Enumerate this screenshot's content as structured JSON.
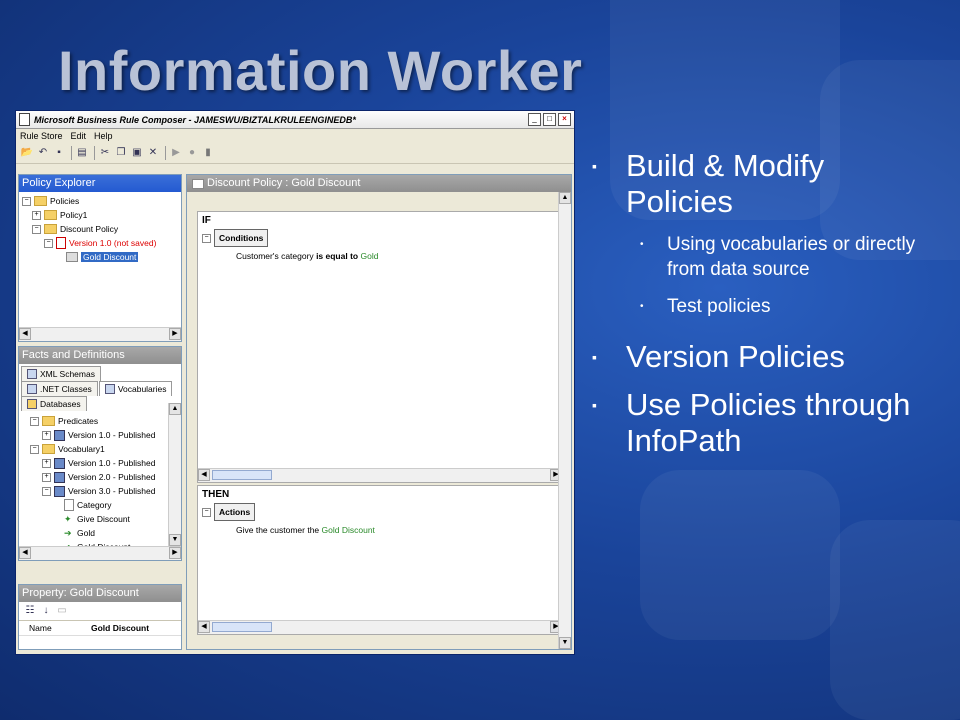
{
  "slide": {
    "title": "Information Worker",
    "bullets": [
      {
        "text": "Build & Modify Policies",
        "sub": [
          "Using vocabularies or directly from data source",
          "Test policies"
        ]
      },
      {
        "text": "Version Policies",
        "sub": []
      },
      {
        "text": "Use Policies through InfoPath",
        "sub": []
      }
    ]
  },
  "app": {
    "title": "Microsoft Business Rule Composer - JAMESWU/BIZTALKRULEENGINEDB*",
    "menu": [
      "Rule Store",
      "Edit",
      "Help"
    ],
    "policy_explorer": {
      "header": "Policy Explorer",
      "root": "Policies",
      "items": [
        "Policy1",
        "Discount Policy",
        "Version 1.0 (not saved)",
        "Gold Discount"
      ]
    },
    "facts": {
      "header": "Facts and Definitions",
      "tabs": [
        "XML Schemas",
        ".NET Classes",
        "Vocabularies",
        "Databases"
      ],
      "items": [
        "Predicates",
        "Version 1.0 - Published",
        "Vocabulary1",
        "Version 1.0 - Published",
        "Version 2.0 - Published",
        "Version 3.0 - Published",
        "Category",
        "Give Discount",
        "Gold",
        "Gold Discount"
      ]
    },
    "property": {
      "header": "Property: Gold Discount",
      "name_label": "Name",
      "name_value": "Gold Discount"
    },
    "editor": {
      "header": "Discount Policy : Gold Discount",
      "if_label": "IF",
      "conditions_label": "Conditions",
      "condition": {
        "pre": "Customer's category",
        "op": "is equal to",
        "val": "Gold"
      },
      "then_label": "THEN",
      "actions_label": "Actions",
      "action": {
        "pre": "Give the customer the",
        "val": "Gold Discount"
      }
    }
  }
}
